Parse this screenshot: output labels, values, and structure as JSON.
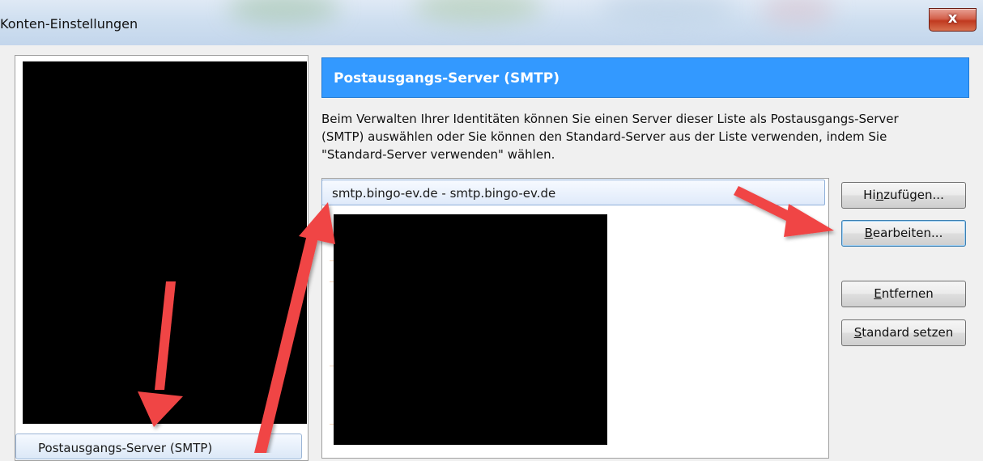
{
  "window": {
    "title": "Konten-Einstellungen",
    "close_symbol": "x"
  },
  "sidebar": {
    "selected_item": "Postausgangs-Server (SMTP)"
  },
  "main": {
    "header": "Postausgangs-Server (SMTP)",
    "description_lines": [
      "Beim Verwalten Ihrer Identitäten können Sie einen Server dieser Liste als Postausgangs-Server",
      "(SMTP) auswählen oder Sie können den Standard-Server aus der Liste verwenden, indem Sie",
      "\"Standard-Server verwenden\" wählen."
    ],
    "servers": [
      {
        "label": "smtp.bingo-ev.de - smtp.bingo-ev.de",
        "selected": true
      }
    ]
  },
  "buttons": {
    "add": {
      "pre": "Hi",
      "mnemonic": "n",
      "post": "zufügen..."
    },
    "edit": {
      "pre": "",
      "mnemonic": "B",
      "post": "earbeiten..."
    },
    "remove": {
      "pre": "",
      "mnemonic": "E",
      "post": "ntfernen"
    },
    "set_default": {
      "pre": "",
      "mnemonic": "S",
      "post": "tandard setzen"
    }
  },
  "colors": {
    "header_bg": "#3399ff",
    "arrow": "#f04545",
    "redaction": "#000000"
  }
}
